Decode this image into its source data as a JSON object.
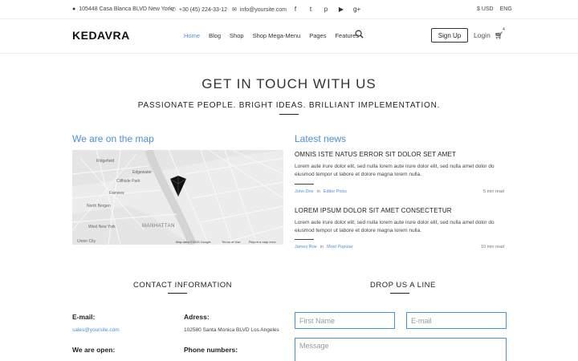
{
  "topbar": {
    "address": "105448 Casa Blanca BLVD New York",
    "phone": "+30 (45) 224-33-12",
    "email": "info@yoursite.com",
    "social_icons": [
      "facebook-icon",
      "twitter-icon",
      "pinterest-icon",
      "youtube-icon",
      "google-plus-icon"
    ],
    "currency": "$ USD",
    "language": "ENG"
  },
  "header": {
    "logo": "KEDAVRA",
    "nav": [
      "Home",
      "Blog",
      "Shop",
      "Shop Mega-Menu",
      "Pages",
      "Features"
    ],
    "active_nav": "Home",
    "signup": "Sign Up",
    "login": "Login",
    "cart_count": "4"
  },
  "hero": {
    "title": "GET IN TOUCH WITH US",
    "subtitle": "PASSIONATE PEOPLE. BRIGHT IDEAS. BRILLIANT IMPLEMENTATION."
  },
  "map": {
    "title": "We are on the map",
    "labels": [
      "Ridgefield",
      "Edgewater",
      "Cliffside Park",
      "Fairview",
      "North Bergen",
      "West New York",
      "MANHATTAN",
      "Union City"
    ],
    "footer": [
      "Map data ©2015 Google",
      "Terms of Use",
      "Report a map error"
    ]
  },
  "news": {
    "title": "Latest news",
    "items": [
      {
        "headline": "OMNIS ISTE NATUS ERROR SIT DOLOR SET AMET",
        "body": "Lorem aute irure dolor elit, sed nulla lorem aute irure dolor elit, sed nulla amet dolor do eiusmod tempor ut labore et dolore magna lorem nulla.",
        "author": "John Doe",
        "in": "in",
        "category": "Editor Picks",
        "time": "5 min read"
      },
      {
        "headline": "LOREM IPSUM DOLOR SIT AMET CONSECTETUR",
        "body": "Lorem aute irure dolor elit, sed nulla lorem aute irure dolor elit, sed nulla amet dolor do eiusmod tempor ut labore et dolore magna lorem nulla.",
        "author": "James Roe",
        "in": "in",
        "category": "Most Popular",
        "time": "10 min read"
      }
    ]
  },
  "contact": {
    "heading": "CONTACT INFORMATION",
    "email_label": "E-mail:",
    "email_value": "sales@yoursite.com",
    "address_label": "Adress:",
    "address_value": "102580 Santa Monica BLVD Los Angeles",
    "open_label": "We are open:",
    "phone_label": "Phone numbers:"
  },
  "form": {
    "heading": "DROP US A LINE",
    "first_name_placeholder": "First Name",
    "email_placeholder": "E-mail",
    "message_placeholder": "Message"
  }
}
